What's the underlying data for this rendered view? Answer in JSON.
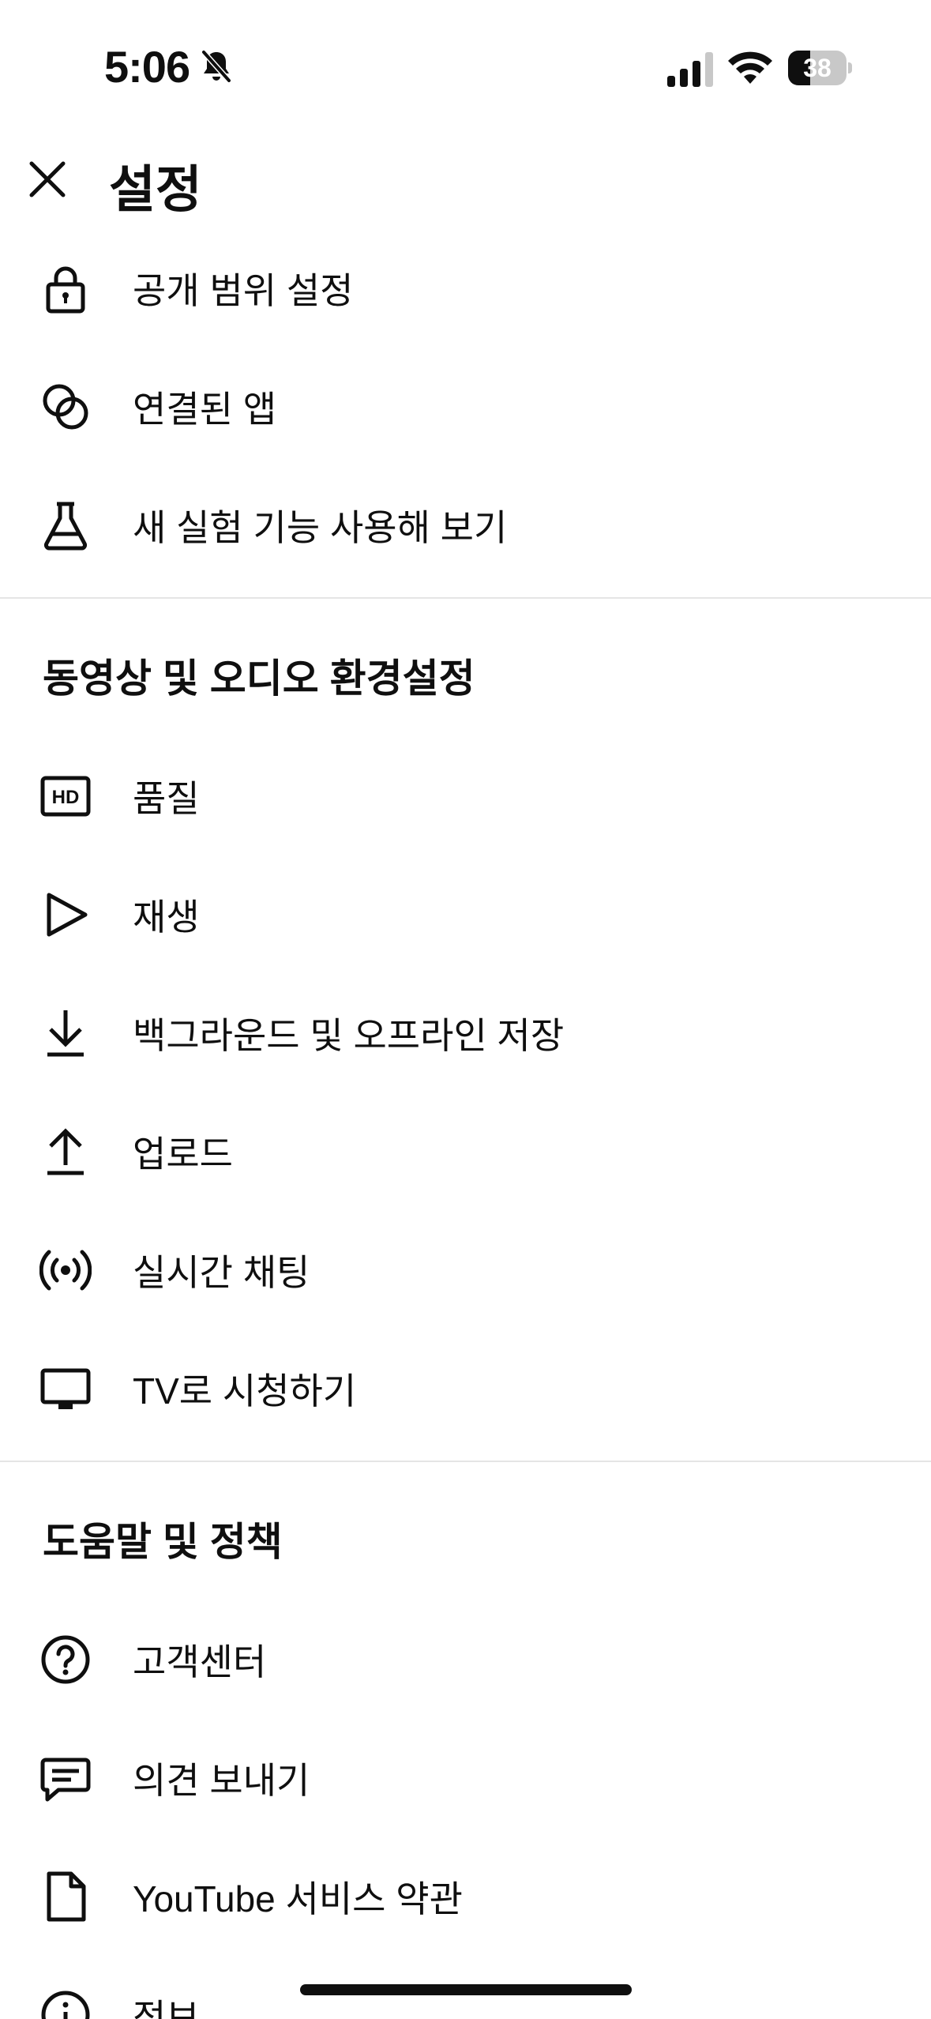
{
  "status_bar": {
    "time": "5:06",
    "battery": "38",
    "battery_level": 0.38
  },
  "header": {
    "title": "설정"
  },
  "account_items": [
    {
      "label": "공개 범위 설정",
      "icon": "lock-icon"
    },
    {
      "label": "연결된 앱",
      "icon": "linked-circles-icon"
    },
    {
      "label": "새 실험 기능 사용해 보기",
      "icon": "flask-icon"
    }
  ],
  "video_section": {
    "title": "동영상 및 오디오 환경설정",
    "items": [
      {
        "label": "품질",
        "icon": "hd-icon"
      },
      {
        "label": "재생",
        "icon": "play-icon"
      },
      {
        "label": "백그라운드 및 오프라인 저장",
        "icon": "download-icon"
      },
      {
        "label": "업로드",
        "icon": "upload-icon"
      },
      {
        "label": "실시간 채팅",
        "icon": "live-broadcast-icon"
      },
      {
        "label": "TV로 시청하기",
        "icon": "tv-icon"
      }
    ]
  },
  "help_section": {
    "title": "도움말 및 정책",
    "items": [
      {
        "label": "고객센터",
        "icon": "help-circle-icon"
      },
      {
        "label": "의견 보내기",
        "icon": "feedback-icon"
      },
      {
        "label": "YouTube 서비스 약관",
        "icon": "document-icon"
      },
      {
        "label": "정보",
        "icon": "info-icon"
      }
    ]
  }
}
